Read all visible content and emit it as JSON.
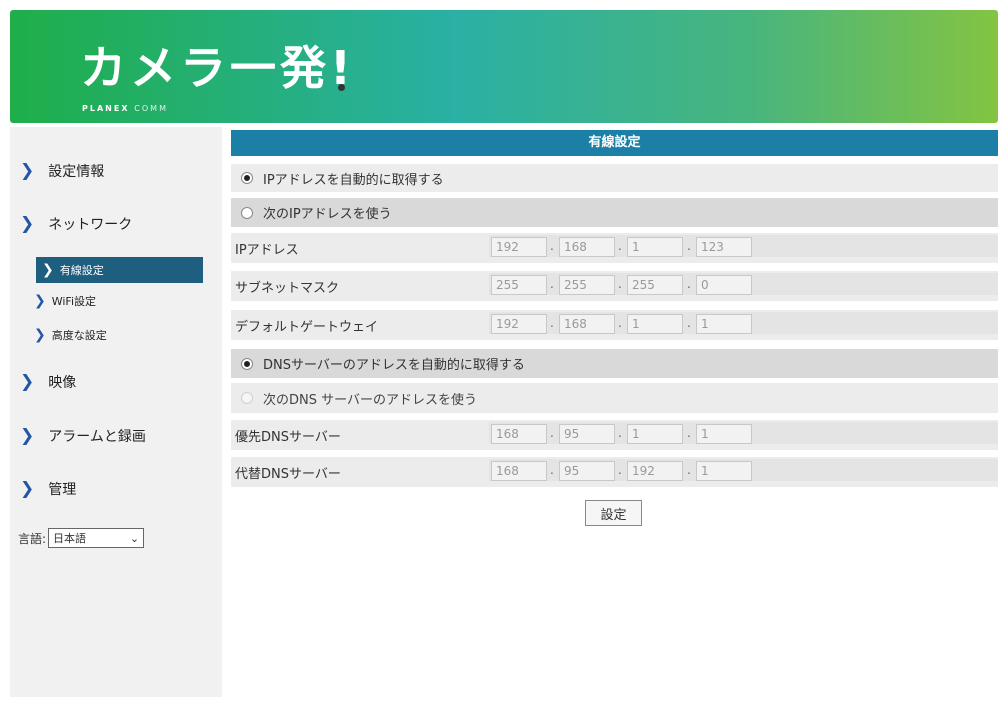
{
  "header": {
    "title": "カメラ一発",
    "exclaim": "!",
    "brand": "PLANEX",
    "brand_suffix": "COMM"
  },
  "sidebar": {
    "items": [
      {
        "label": "設定情報"
      },
      {
        "label": "ネットワーク"
      },
      {
        "label": "映像"
      },
      {
        "label": "アラームと録画"
      },
      {
        "label": "管理"
      }
    ],
    "sub_items": [
      {
        "label": "有線設定",
        "active": true
      },
      {
        "label": "WiFi設定"
      },
      {
        "label": "高度な設定"
      }
    ],
    "language": {
      "label": "言語:",
      "value": "日本語"
    }
  },
  "main": {
    "title": "有線設定",
    "auto_ip_label": "IPアドレスを自動的に取得する",
    "manual_ip_label": "次のIPアドレスを使う",
    "ip_label": "IPアドレス",
    "subnet_label": "サブネットマスク",
    "gateway_label": "デフォルトゲートウェイ",
    "dns_auto_label": "DNSサーバーのアドレスを自動的に取得する",
    "dns_manual_label": "次のDNS サーバーのアドレスを使う",
    "dns1_label": "優先DNSサーバー",
    "dns2_label": "代替DNSサーバー",
    "ip": [
      "192",
      "168",
      "1",
      "123"
    ],
    "subnet": [
      "255",
      "255",
      "255",
      "0"
    ],
    "gateway": [
      "192",
      "168",
      "1",
      "1"
    ],
    "dns1": [
      "168",
      "95",
      "1",
      "1"
    ],
    "dns2": [
      "168",
      "95",
      "192",
      "1"
    ],
    "submit_label": "設定"
  }
}
